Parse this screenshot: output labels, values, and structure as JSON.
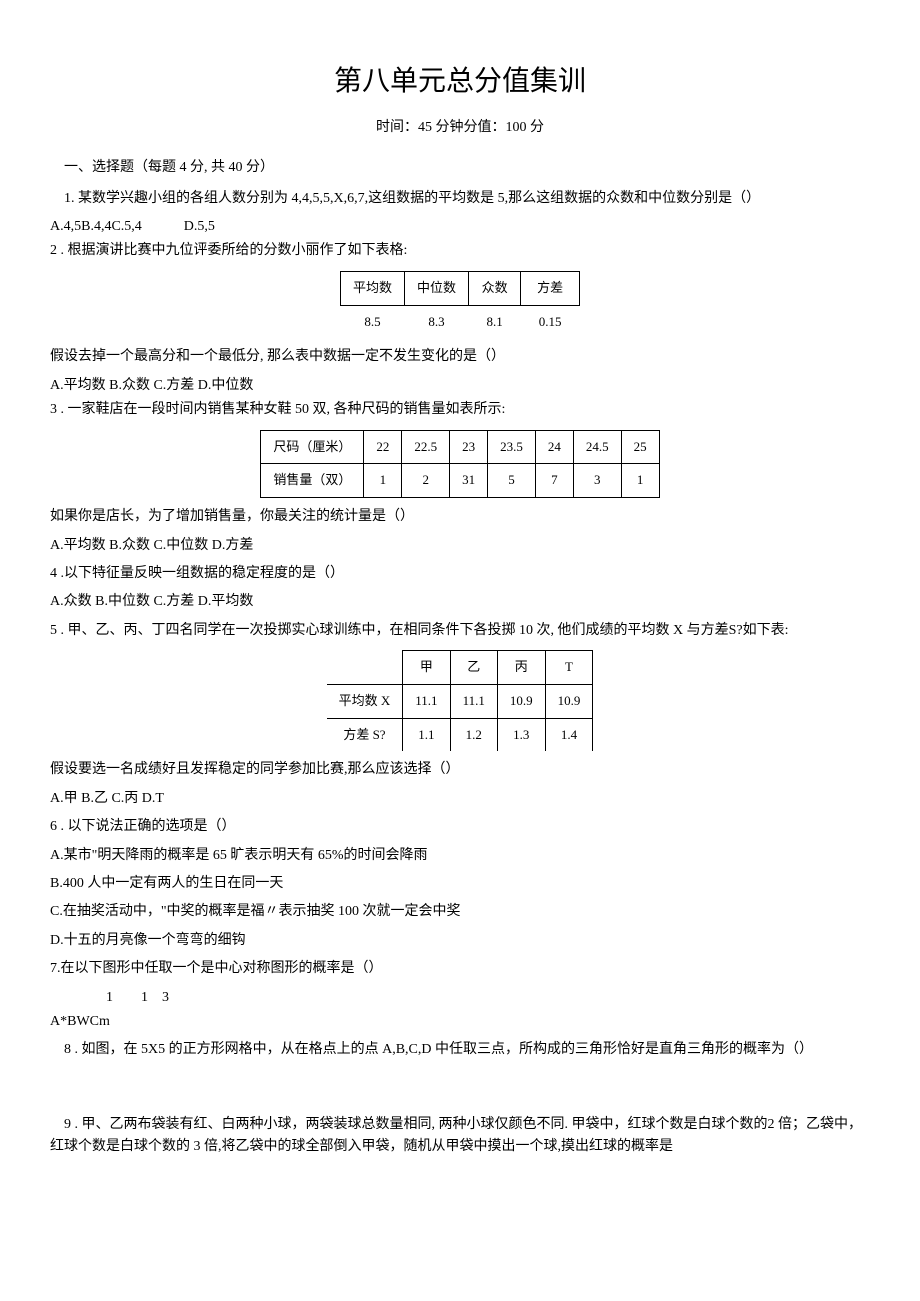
{
  "title": "第八单元总分值集训",
  "subtitle": "时间：45 分钟分值：100 分",
  "section1_header": "一、选择题（每题 4 分, 共 40 分）",
  "q1": {
    "text": "1. 某数学兴趣小组的各组人数分别为 4,4,5,5,X,6,7,这组数据的平均数是 5,那么这组数据的众数和中位数分别是（）",
    "opts": "A.4,5B.4,4C.5,4            D.5,5"
  },
  "q2": {
    "text": "2    . 根据演讲比赛中九位评委所给的分数小丽作了如下表格:",
    "after": "假设去掉一个最高分和一个最低分, 那么表中数据一定不发生变化的是（）",
    "opts": "A.平均数 B.众数 C.方差 D.中位数",
    "th": [
      "平均数",
      "中位数",
      "众数",
      "方差"
    ],
    "row": [
      "8.5",
      "8.3",
      "8.1",
      "0.15"
    ]
  },
  "q3": {
    "text": "3    . 一家鞋店在一段时间内销售某种女鞋 50 双, 各种尺码的销售量如表所示:",
    "after": "如果你是店长，为了增加销售量，你最关注的统计量是（）",
    "opts": "A.平均数 B.众数 C.中位数 D.方差",
    "h1": "尺码（厘米）",
    "h2": "销售量（双）",
    "r1": [
      "22",
      "22.5",
      "23",
      "23.5",
      "24",
      "24.5",
      "25"
    ],
    "r2": [
      "1",
      "2",
      "31",
      "5",
      "7",
      "3",
      "1"
    ]
  },
  "q4": {
    "text": "4    .以下特征量反映一组数据的稳定程度的是（）",
    "opts": "A.众数 B.中位数 C.方差 D.平均数"
  },
  "q5": {
    "text": "5    . 甲、乙、丙、丁四名同学在一次投掷实心球训练中，在相同条件下各投掷 10 次, 他们成绩的平均数 X 与方差S?如下表:",
    "after": "假设要选一名成绩好且发挥稳定的同学参加比赛,那么应该选择（）",
    "opts": "A.甲 B.乙 C.丙 D.T",
    "th": [
      "",
      "甲",
      "乙",
      "丙",
      "T"
    ],
    "r1h": "平均数 X",
    "r1": [
      "11.1",
      "11.1",
      "10.9",
      "10.9"
    ],
    "r2h": "方差 S?",
    "r2": [
      "1.1",
      "1.2",
      "1.3",
      "1.4"
    ]
  },
  "q6": {
    "text": "6    . 以下说法正确的选项是（）",
    "a": "A.某市\"明天降雨的概率是 65 旷表示明天有 65%的时间会降雨",
    "b": "B.400 人中一定有两人的生日在同一天",
    "c": "C.在抽奖活动中，\"中奖的概率是福〃表示抽奖 100 次就一定会中奖",
    "d": "D.十五的月亮像一个弯弯的细钩"
  },
  "q7": {
    "text": "7.在以下图形中任取一个是中心对称图形的概率是（）",
    "frac": "    1        1    3",
    "opts": "A*BWCm"
  },
  "q8": {
    "text": "8    . 如图，在 5X5 的正方形网格中，从在格点上的点 A,B,C,D 中任取三点，所构成的三角形恰好是直角三角形的概率为（）"
  },
  "q9": {
    "text": "9    . 甲、乙两布袋装有红、白两种小球，两袋装球总数量相同, 两种小球仅颜色不同. 甲袋中，红球个数是白球个数的2 倍；乙袋中，红球个数是白球个数的 3 倍,将乙袋中的球全部倒入甲袋，随机从甲袋中摸出一个球,摸出红球的概率是"
  }
}
